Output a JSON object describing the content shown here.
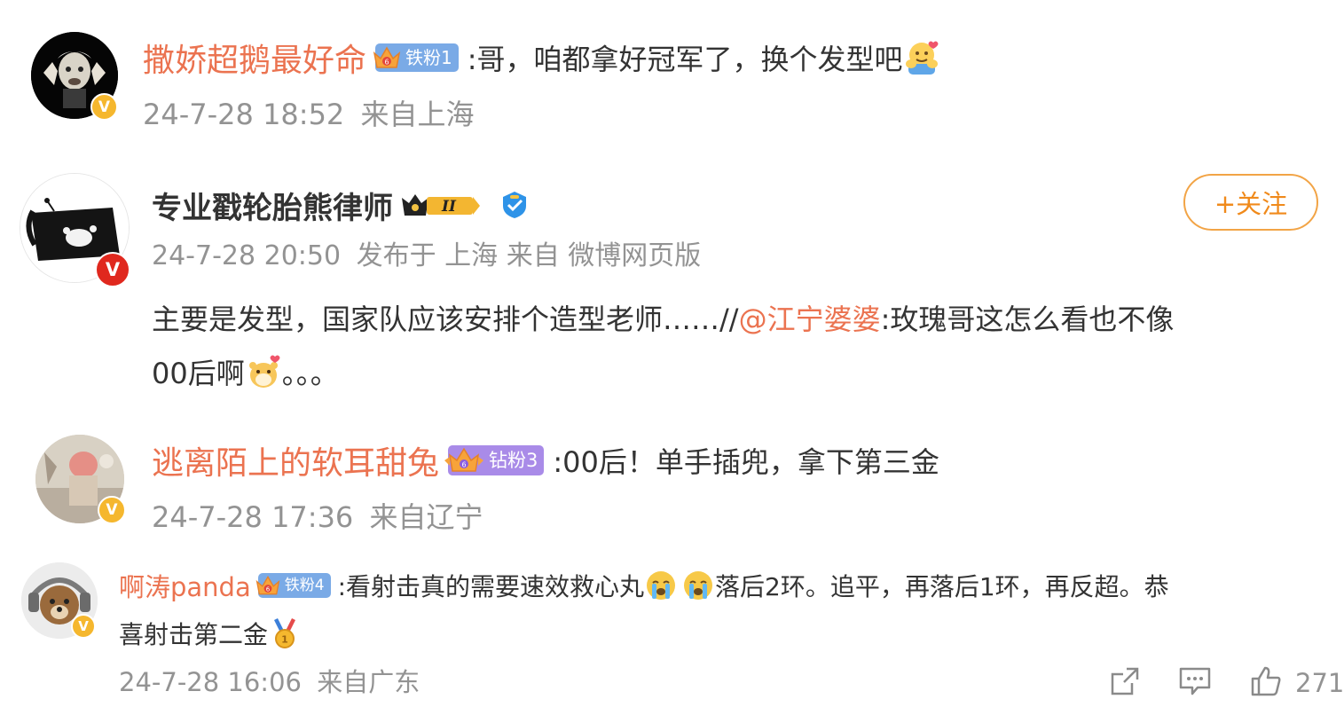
{
  "comments": [
    {
      "username": "撒娇超鹅最好命",
      "fan_badge": "铁粉1",
      "text": ":哥，咱都拿好冠军了，换个发型吧",
      "emoji": "hug-emoji",
      "time": "24-7-28 18:52",
      "location": "来自上海",
      "verified": "yellow-v"
    },
    {
      "username": "专业戳轮胎熊律师",
      "member_badge": "II",
      "follow_button": "+关注",
      "time": "24-7-28 20:50",
      "publish_info": "发布于 上海 来自 微博网页版",
      "text_before": "主要是发型，国家队应该安排个造型老师……//",
      "mention": "@江宁婆婆",
      "text_after": ":玫瑰哥这怎么看也不像",
      "text_line2_before": "00后啊",
      "text_line2_after": "。。。",
      "emoji": "hamster-emoji",
      "verified": "red-v"
    },
    {
      "username": "逃离陌上的软耳甜兔",
      "fan_badge": "钻粉3",
      "text": ":00后！单手插兜，拿下第三金",
      "time": "24-7-28 17:36",
      "location": "来自辽宁",
      "verified": "yellow-v"
    },
    {
      "username": "啊涛panda",
      "fan_badge": "铁粉4",
      "text_before": ":看射击真的需要速效救心丸",
      "text_after": "落后2环。追平，再落后1环，再反超。恭",
      "text_line2": "喜射击第二金",
      "emojis": [
        "crying-emoji",
        "crying-emoji",
        "medal-emoji"
      ],
      "time": "24-7-28 16:06",
      "location": "来自广东",
      "verified": "yellow-v"
    }
  ],
  "actions": {
    "share_icon": "share-icon",
    "comment_icon": "comment-icon",
    "like_icon": "thumbs-up-icon",
    "like_count": "271"
  },
  "colors": {
    "username_orange": "#eb7350",
    "meta_gray": "#939393",
    "iron_fan_blue": "#7aaae6",
    "diamond_fan_purple": "#a98be8",
    "follow_orange": "#f08a1b",
    "verified_yellow": "#f5b72e",
    "verified_red": "#e0281e"
  }
}
